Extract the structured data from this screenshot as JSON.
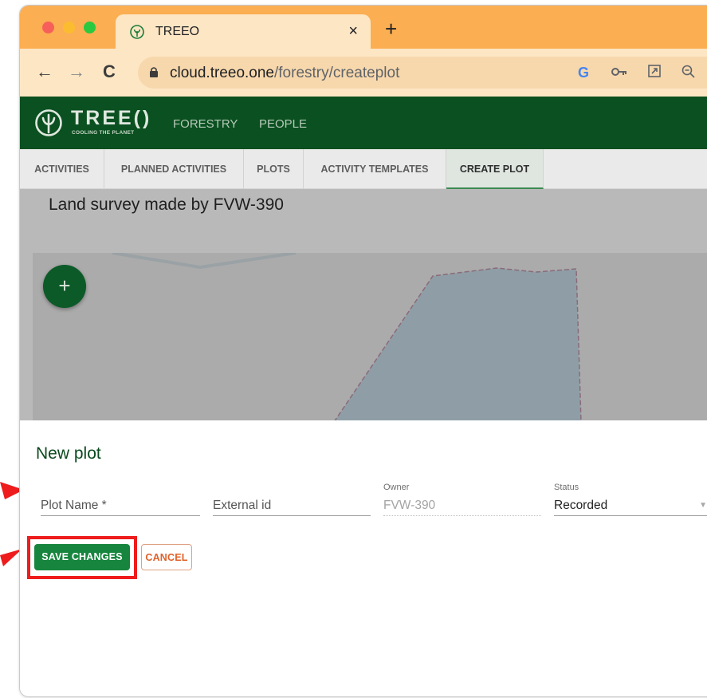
{
  "browser": {
    "tab_title": "TREEO",
    "tab_close": "×",
    "new_tab": "+",
    "url_host": "cloud.treeo.one",
    "url_path": "/forestry/createplot",
    "nav": {
      "back": "←",
      "forward": "→",
      "reload": "C"
    },
    "omnibox_icons": [
      "google-g-icon",
      "key-icon",
      "open-external-icon",
      "zoom-icon"
    ],
    "google_letter": "G"
  },
  "app": {
    "brand_name": "TREE()",
    "brand_tagline": "COOLING THE PLANET",
    "nav": [
      "FORESTRY",
      "PEOPLE"
    ]
  },
  "subtabs": [
    {
      "label": "ACTIVITIES"
    },
    {
      "label": "PLANNED ACTIVITIES"
    },
    {
      "label": "PLOTS"
    },
    {
      "label": "ACTIVITY TEMPLATES"
    },
    {
      "label": "CREATE PLOT",
      "active": true
    }
  ],
  "map": {
    "title": "Land survey made by FVW-390",
    "fab_label": "+"
  },
  "form": {
    "title": "New plot",
    "plot_name": {
      "placeholder": "Plot Name *"
    },
    "external_id": {
      "placeholder": "External id"
    },
    "owner": {
      "label": "Owner",
      "value": "FVW-390"
    },
    "status": {
      "label": "Status",
      "value": "Recorded"
    },
    "save_label": "SAVE CHANGES",
    "cancel_label": "CANCEL"
  },
  "colors": {
    "tab_strip": "#fbae52",
    "app_header": "#0b5020",
    "primary_button": "#17853d",
    "cancel_text": "#e0622a",
    "annotation_red": "#ee1c1c"
  }
}
